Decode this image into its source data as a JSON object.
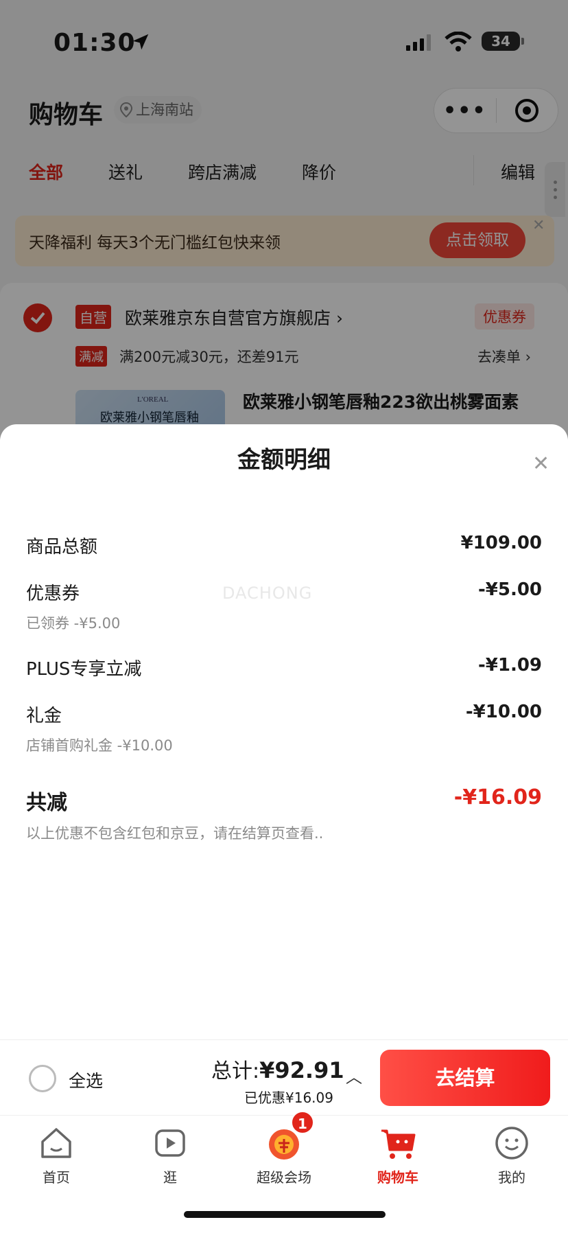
{
  "status": {
    "time": "01:30",
    "battery": "34"
  },
  "header": {
    "title": "购物车",
    "location": "上海南站"
  },
  "tabs": [
    "全部",
    "送礼",
    "跨店满减",
    "降价"
  ],
  "edit_label": "编辑",
  "banner": {
    "text": "天降福利 每天3个无门槛红包快来领",
    "button": "点击领取"
  },
  "store": {
    "tag": "自营",
    "name": "欧莱雅京东自营官方旗舰店",
    "coupon": "优惠券",
    "promo_tag": "满减",
    "promo_text": "满200元减30元，还差91元",
    "promo_link": "去凑单",
    "product_img_brand": "L'OREAL",
    "product_img_label": "欧莱雅小钢笔唇釉",
    "product_title": "欧莱雅小钢笔唇釉223欲出桃雾面素"
  },
  "sheet": {
    "title": "金额明细",
    "watermark": "DACHONG",
    "rows": [
      {
        "label": "商品总额",
        "value": "¥109.00"
      },
      {
        "label": "优惠券",
        "value": "-¥5.00",
        "sub": "已领券 -¥5.00"
      },
      {
        "label": "PLUS专享立减",
        "value": "-¥1.09"
      },
      {
        "label": "礼金",
        "value": "-¥10.00",
        "sub": "店铺首购礼金 -¥10.00"
      }
    ],
    "total_label": "共减",
    "total_value": "-¥16.09",
    "note": "以上优惠不包含红包和京豆，请在结算页查看.."
  },
  "checkout": {
    "select_all": "全选",
    "sum_label": "总计:",
    "sum_value": "¥92.91",
    "saved": "已优惠¥16.09",
    "button": "去结算"
  },
  "tabbar": {
    "items": [
      "首页",
      "逛",
      "超级会场",
      "购物车",
      "我的"
    ],
    "badge": "1"
  },
  "colors": {
    "accent": "#e1251b",
    "banner_bg": "#fcebd0"
  }
}
